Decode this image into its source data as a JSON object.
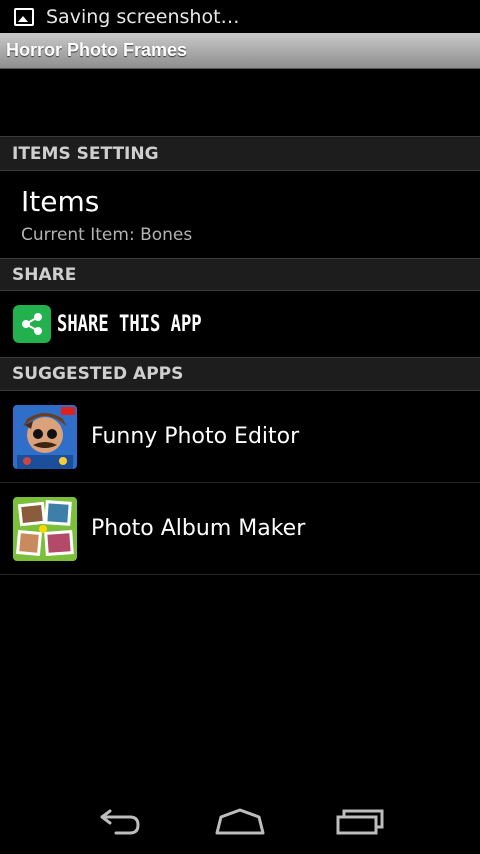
{
  "status_bar": {
    "text": "Saving screenshot…"
  },
  "app_title": "Horror Photo Frames",
  "sections": {
    "items_setting": "ITEMS SETTING",
    "share": "SHARE",
    "suggested_apps": "SUGGESTED APPS"
  },
  "items": {
    "title": "Items",
    "current_label": "Current Item:",
    "current_value": "Bones",
    "subtitle": "Current Item:  Bones"
  },
  "share": {
    "label": "SHARE THIS APP",
    "icon": "share-icon"
  },
  "suggested_apps": [
    {
      "label": "Funny Photo Editor",
      "icon": "funny-photo-editor-icon"
    },
    {
      "label": "Photo Album Maker",
      "icon": "photo-album-maker-icon"
    }
  ],
  "nav": {
    "back": "back-icon",
    "home": "home-icon",
    "recents": "recents-icon"
  },
  "colors": {
    "share_green": "#22b14c",
    "header_bg": "#1d1d1d",
    "title_bar": "#a9a9a9"
  }
}
